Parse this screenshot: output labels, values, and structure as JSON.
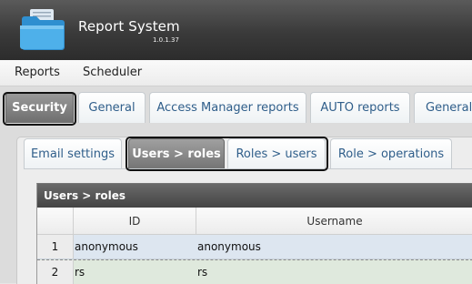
{
  "app": {
    "title": "Report System",
    "version": "1.0.1.37"
  },
  "menu": {
    "items": [
      "Reports",
      "Scheduler"
    ]
  },
  "tabs": [
    {
      "label": "Security",
      "active": true
    },
    {
      "label": "General",
      "active": false
    },
    {
      "label": "Access Manager reports",
      "active": false
    },
    {
      "label": "AUTO reports",
      "active": false
    },
    {
      "label": "General",
      "active": false
    }
  ],
  "subtabs": [
    {
      "label": "Email settings",
      "active": false
    },
    {
      "label": "Users > roles",
      "active": true
    },
    {
      "label": "Roles > users",
      "active": false
    },
    {
      "label": "Role > operations",
      "active": false
    }
  ],
  "grid": {
    "title": "Users > roles",
    "columns": [
      "ID",
      "Username"
    ],
    "rows": [
      {
        "num": "1",
        "id": "anonymous",
        "username": "anonymous"
      },
      {
        "num": "2",
        "id": "rs",
        "username": "rs"
      }
    ]
  },
  "colors": {
    "accent_text": "#2f5e8a",
    "active_tab": "#7a7a7a",
    "titlebar": "#3a3a3a"
  },
  "icons": {
    "logo": "folder-icon"
  }
}
